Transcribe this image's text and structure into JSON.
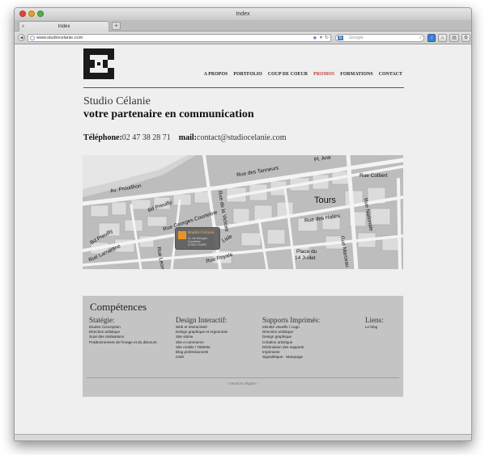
{
  "browser": {
    "window_title": "Index",
    "tab_label": "Index",
    "tab_close": "x",
    "new_tab": "+",
    "url": "www.studiocelanie.com",
    "search_placeholder": "Google",
    "search_engine_glyph": "G"
  },
  "site": {
    "nav": [
      {
        "label": "A PROPOS"
      },
      {
        "label": "PORTFOLIO"
      },
      {
        "label": "COUP DE COEUR"
      },
      {
        "label": "PROMOS",
        "active": true
      },
      {
        "label": "FORMATIONS"
      },
      {
        "label": "CONTACT"
      }
    ],
    "active_nav_color": "#c0392b",
    "studio_name": "Studio Célanie",
    "tagline": "votre partenaire en communication",
    "phone_label": "Téléphone:",
    "phone": "02 47 38 28 71",
    "mail_label": "mail:",
    "mail": "contact@studiocelanie.com"
  },
  "map": {
    "labels": {
      "proudhon": "Av. Proudhon",
      "tanneurs": "Rue des Tanneurs",
      "plan": "Pl. Ana",
      "colbert": "Rue Colbert",
      "preuilly": "Bd Preuilly",
      "courteline": "Rue Georges Courteline",
      "victoire": "Rue de la Victoire",
      "tours": "Tours",
      "halles": "Rue des Halles",
      "nationale": "Rue Nationale",
      "preuilly2": "Bd Preuilly",
      "lamartine": "Rue Lamartine",
      "lisle": "Lisle",
      "leon": "Rue Léon",
      "royale": "Rue Royale",
      "place": "Place du",
      "juillet": "14 Juillet",
      "marceau": "Rue Marceau"
    },
    "pin_name": "Studio Célanie",
    "pin_address": [
      "11 rue Georges",
      "Courteline",
      "37000 TOURS"
    ]
  },
  "competences": {
    "title": "Compétences",
    "columns": [
      {
        "heading": "Statégie:",
        "items": [
          "Etudes Conception",
          "Direction artistique",
          "Suivi des réalisations",
          "Positionnement de l'image et du discours"
        ]
      },
      {
        "heading": "Design Interactif:",
        "items": [
          "Web et interactivité",
          "Design graphique et ergonomie",
          "Site vitrine",
          "Site e-commerce",
          "Site mobile / Tablette",
          "Blog professionnels",
          "CMS"
        ]
      },
      {
        "heading": "Supports Imprimés:",
        "items": [
          "Identité visuelle / Logo",
          "Direction artistique",
          "Design graphique",
          "Création artistique",
          "Déclinaison des supports",
          "Imprimerie",
          "Signalétique - Marquage"
        ]
      },
      {
        "heading": "Liens:",
        "items": [
          "Le blog"
        ]
      }
    ],
    "footer": "- mentions légales -"
  }
}
